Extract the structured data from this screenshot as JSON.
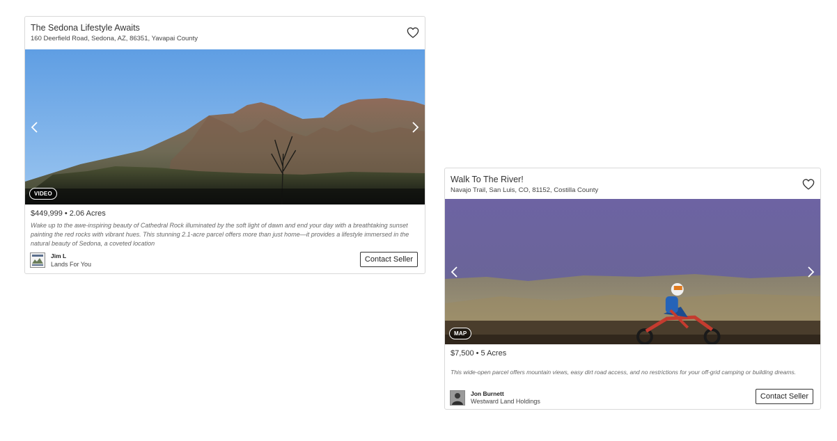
{
  "listings": [
    {
      "title": "The Sedona Lifestyle Awaits",
      "address": "160 Deerfield Road, Sedona, AZ, 86351, Yavapai County",
      "media_badge": "VIDEO",
      "price": "$449,999",
      "separator": "•",
      "acres": "2.06 Acres",
      "description": "Wake up to the awe-inspiring beauty of Cathedral Rock illuminated by the soft light of dawn and end your day with a breathtaking sunset painting the red rocks with vibrant hues. This stunning 2.1-acre parcel offers more than just home—it provides a lifestyle immersed in the natural beauty of Sedona, a coveted location",
      "seller_name": "Jim L",
      "seller_company": "Lands For You",
      "contact_label": "Contact Seller",
      "favorite_icon": "heart-outline-icon",
      "arrow_left_icon": "chevron-left-icon",
      "arrow_right_icon": "chevron-right-icon"
    },
    {
      "title": "Walk To The River!",
      "address": "Navajo Trail, San Luis, CO, 81152, Costilla County",
      "media_badge": "MAP",
      "price": "$7,500",
      "separator": "•",
      "acres": "5 Acres",
      "description": "This wide-open parcel offers mountain views, easy dirt road access, and no restrictions for your off-grid camping or building dreams.",
      "seller_name": "Jon Burnett",
      "seller_company": "Westward Land Holdings",
      "contact_label": "Contact Seller",
      "favorite_icon": "heart-outline-icon",
      "arrow_left_icon": "chevron-left-icon",
      "arrow_right_icon": "chevron-right-icon"
    }
  ],
  "colors": {
    "border": "#d9d9d9",
    "text": "#333333",
    "description_text": "#666666",
    "sky": "#6ea8e6",
    "badge_bg": "#2b2b2b"
  }
}
